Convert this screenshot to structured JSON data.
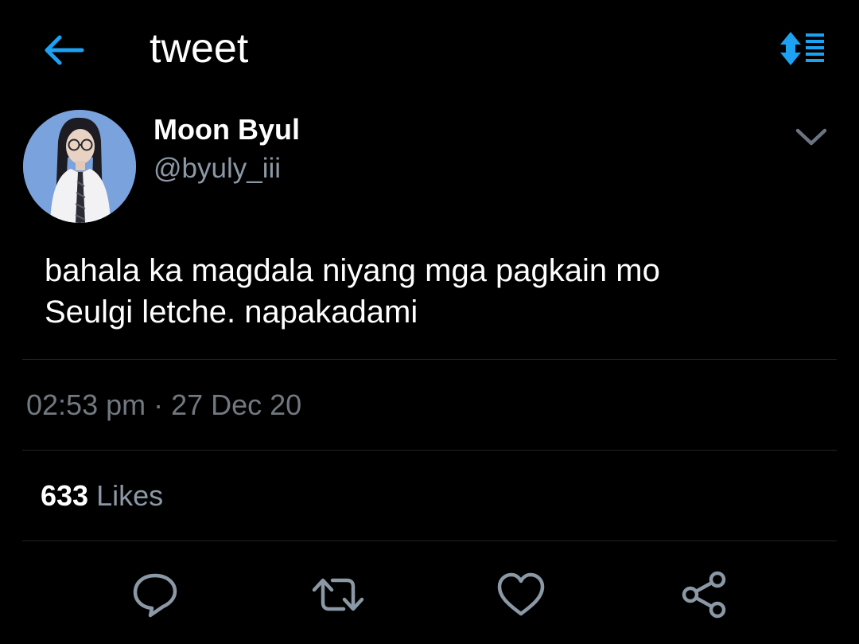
{
  "header": {
    "title": "tweet",
    "back_icon": "arrow-left-icon",
    "sort_icon": "sort-list-icon",
    "accent_color": "#1da1f2"
  },
  "tweet": {
    "author": {
      "display_name": "Moon Byul",
      "handle": "@byuly_iii",
      "avatar_icon": "user-avatar"
    },
    "text_line1": "bahala ka magdala niyang mga pagkain mo",
    "text_line2": "Seulgi letche. napakadami",
    "timestamp": "02:53 pm · 27 Dec 20",
    "likes_count": "633",
    "likes_label": "Likes"
  },
  "actions": [
    {
      "name": "reply",
      "icon": "speech-bubble-icon"
    },
    {
      "name": "retweet",
      "icon": "retweet-icon"
    },
    {
      "name": "like",
      "icon": "heart-icon"
    },
    {
      "name": "share",
      "icon": "share-icon"
    }
  ],
  "colors": {
    "background": "#000000",
    "text_primary": "#ffffff",
    "text_secondary": "#8b98a5",
    "icon_gray": "#8b98a5",
    "divider": "#1f2328"
  }
}
